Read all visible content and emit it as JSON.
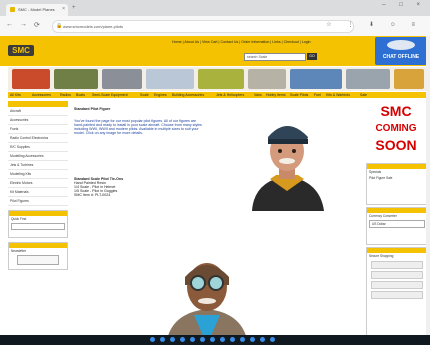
{
  "browser": {
    "tab_title": "SMC - Model Planes",
    "tab_close": "×",
    "new_tab": "+",
    "url": "www.smcmodels.com/plane-pilots",
    "win_controls": "– □ ×",
    "nav_back": "←",
    "nav_forward": "→",
    "nav_reload": "⟳",
    "toolbar_icons": "☆ ⋮ ⬇ ☺ ≡"
  },
  "header": {
    "logo": "SMC",
    "top_links": "Home | About Us | View Cart | Contact Us | Order Information | Links | Checkout | Login",
    "search_placeholder": "search Scale",
    "go_label": "GO",
    "chat_label": "CHAT OFFLINE"
  },
  "navbar": [
    "All Kits",
    "Accessories",
    "Radios",
    "Boats",
    "Semi-Scale Equipment",
    "Scale",
    "Engines",
    "Building Accessories",
    "Jets & Helicopters",
    "Vans",
    "Hobby Items",
    "Scale Pilots",
    "Fuel",
    "Kits & Warbirds",
    "Sale"
  ],
  "left": {
    "head": "",
    "items": [
      "Aircraft",
      "Accessories",
      "Fuels",
      "Radio Control Electronics",
      "R/C Supplies",
      "Modelling Accessories",
      "Jets & Turbines",
      "Modelling Kits",
      "Electric Motors",
      "Kit Materials",
      "Pilot Figures"
    ],
    "box1_label": "Quick Find",
    "box2_label": "Newsletter"
  },
  "content": {
    "title": "Standard Pilot Figure",
    "lines": [
      "You've found the page for our most popular pilot figures. All of our figures are",
      "hand-painted and ready to install in your scale aircraft. Choose from many styles",
      "including WWI, WWII and modern pilots. Available in multiple sizes to suit your",
      "model. Click on any image for more details."
    ],
    "product_title": "Standard Scale Pilot Tie-Ons",
    "product_lines": [
      "Hand Painted Resin",
      "1/4 Scale - Pilot in Helmet",
      "1/5 Scale - Pilot in Goggles",
      "SMC Item #: PLT-0024"
    ]
  },
  "right": {
    "soon_text": [
      "SMC",
      "COMING",
      "SOON"
    ],
    "box1_head": "Specials",
    "box1_text": "Pilot Figure Sale",
    "box2_head": "Currency Converter",
    "box2_select": "US Dollar",
    "box3_head": "Secure Shopping"
  },
  "colors": {
    "accent": "#f4c200",
    "chat": "#2e6fd3",
    "soon": "#d60000"
  }
}
